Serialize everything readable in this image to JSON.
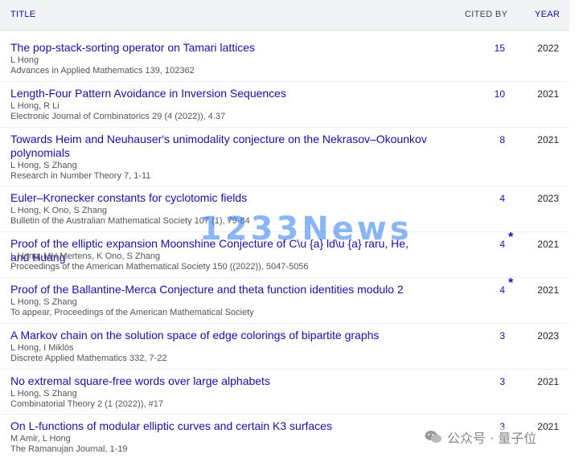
{
  "header": {
    "title": "TITLE",
    "cited_by": "CITED BY",
    "year": "YEAR"
  },
  "articles": [
    {
      "title": "The pop-stack-sorting operator on Tamari lattices",
      "authors": "L Hong",
      "venue": "Advances in Applied Mathematics 139, 102362",
      "cited": "15",
      "star": "",
      "year": "2022"
    },
    {
      "title": "Length-Four Pattern Avoidance in Inversion Sequences",
      "authors": "L Hong, R Li",
      "venue": "Electronic Journal of Combinatorics 29 (4 (2022)), 4.37",
      "cited": "10",
      "star": "",
      "year": "2021"
    },
    {
      "title": "Towards Heim and Neuhauser's unimodality conjecture on the Nekrasov–Okounkov polynomials",
      "authors": "L Hong, S Zhang",
      "venue": "Research in Number Theory 7, 1-11",
      "cited": "8",
      "star": "",
      "year": "2021"
    },
    {
      "title": "Euler–Kronecker constants for cyclotomic fields",
      "authors": "L Hong, K Ono, S Zhang",
      "venue": "Bulletin of the Australian Mathematical Society 107 (1), 79-84",
      "cited": "4",
      "star": "",
      "year": "2023"
    },
    {
      "title": "Proof of the elliptic expansion Moonshine Conjecture of C\\u {a} ld\\u {a} raru, He, and Huang",
      "authors": "L Hong, MH Mertens, K Ono, S Zhang",
      "venue": "Proceedings of the American Mathematical Society 150 ((2022)), 5047-5056",
      "cited": "4",
      "star": "*",
      "year": "2021"
    },
    {
      "title": "Proof of the Ballantine-Merca Conjecture and theta function identities modulo 2",
      "authors": "L Hong, S Zhang",
      "venue": "To appear, Proceedings of the American Mathematical Society",
      "cited": "4",
      "star": "*",
      "year": "2021"
    },
    {
      "title": "A Markov chain on the solution space of edge colorings of bipartite graphs",
      "authors": "L Hong, I Miklós",
      "venue": "Discrete Applied Mathematics 332, 7-22",
      "cited": "3",
      "star": "",
      "year": "2023"
    },
    {
      "title": "No extremal square-free words over large alphabets",
      "authors": "L Hong, S Zhang",
      "venue": "Combinatorial Theory 2 (1 (2022)), #17",
      "cited": "3",
      "star": "",
      "year": "2021"
    },
    {
      "title": "On L-functions of modular elliptic curves and certain K3 surfaces",
      "authors": "M Amir, L Hong",
      "venue": "The Ramanujan Journal, 1-19",
      "cited": "3",
      "star": "",
      "year": "2021"
    }
  ],
  "watermark": "1233News",
  "wechat": {
    "icon": "wechat-icon",
    "label": "公众号 · 量子位"
  }
}
